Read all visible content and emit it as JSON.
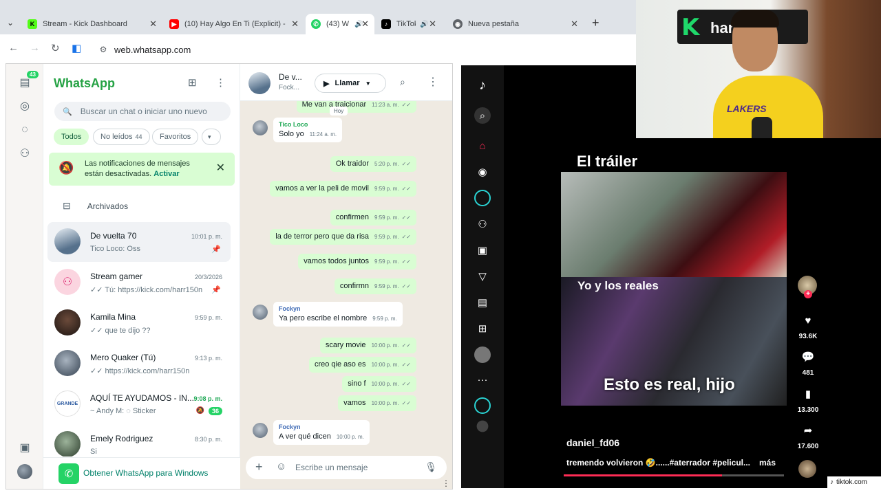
{
  "browser": {
    "tabs": [
      {
        "title": "Stream - Kick Dashboard",
        "icon": "kick-icon",
        "color": "#53fc18"
      },
      {
        "title": "(10) Hay Algo En Ti (Explicit) - Y",
        "icon": "youtube-icon",
        "color": "#ff0000"
      },
      {
        "title": "(43) W",
        "icon": "whatsapp-icon",
        "color": "#25d366"
      },
      {
        "title": "TikTok",
        "icon": "tiktok-icon",
        "color": "#000000"
      },
      {
        "title": "Nueva pestaña",
        "icon": "chrome-icon",
        "color": "#5f6368"
      }
    ],
    "url": "web.whatsapp.com"
  },
  "whatsapp": {
    "rail_badge": "43",
    "title": "WhatsApp",
    "search_placeholder": "Buscar un chat o iniciar uno nuevo",
    "filters": [
      {
        "label": "Todos",
        "count": ""
      },
      {
        "label": "No leídos",
        "count": "44"
      },
      {
        "label": "Favoritos",
        "count": ""
      }
    ],
    "notice": {
      "text": "Las notificaciones de mensajes están desactivadas.",
      "action": "Activar"
    },
    "archived_label": "Archivados",
    "chats": [
      {
        "name": "De vuelta 70",
        "preview": "Tico Loco: Oss",
        "time": "10:01 p. m.",
        "pinned": true
      },
      {
        "name": "Stream gamer",
        "preview": "✓✓ Tú: https://kick.com/harr150n",
        "time": "20/3/2026",
        "pinned": true
      },
      {
        "name": "Kamila Mina",
        "preview": "✓✓ que te dijo ??",
        "time": "9:59 p. m."
      },
      {
        "name": "Mero Quaker (Tú)",
        "preview": "✓✓ https://kick.com/harr150n",
        "time": "9:13 p. m."
      },
      {
        "name": "AQUÍ TE AYUDAMOS - IN...",
        "preview": "~ Andy M: ◌ Sticker",
        "time": "9:08 p. m.",
        "unread": "36",
        "muted": true
      },
      {
        "name": "Emely Rodriguez",
        "preview": "Si",
        "time": "8:30 p. m."
      }
    ],
    "get_app_label": "Obtener WhatsApp para Windows",
    "conversation": {
      "name": "De v...",
      "subtitle": "Fock...",
      "call_label": "Llamar",
      "day_label": "Hoy",
      "messages": [
        {
          "dir": "out",
          "text": "Me van a traicionar",
          "time": "11:23 a. m."
        },
        {
          "dir": "in",
          "sender": "Tico Loco",
          "text": "Solo yo",
          "time": "11:24 a. m."
        },
        {
          "dir": "out",
          "text": "Ok traidor",
          "time": "5:20 p. m."
        },
        {
          "dir": "out",
          "text": "vamos a ver la peli de movil",
          "time": "9:59 p. m."
        },
        {
          "dir": "out",
          "text": "confirmen",
          "time": "9:59 p. m."
        },
        {
          "dir": "out",
          "text": "la de terror pero que da risa",
          "time": "9:59 p. m."
        },
        {
          "dir": "out",
          "text": "vamos todos juntos",
          "time": "9:59 p. m."
        },
        {
          "dir": "out",
          "text": "confirmn",
          "time": "9:59 p. m."
        },
        {
          "dir": "in",
          "sender": "Fockyn",
          "text": "Ya pero escribe el nombre",
          "time": "9:59 p. m."
        },
        {
          "dir": "out",
          "text": "scary movie",
          "time": "10:00 p. m."
        },
        {
          "dir": "out",
          "text": "creo qie aso es",
          "time": "10:00 p. m."
        },
        {
          "dir": "out",
          "text": "sino f",
          "time": "10:00 p. m."
        },
        {
          "dir": "out",
          "text": "vamos",
          "time": "10:00 p. m."
        },
        {
          "dir": "in",
          "sender": "Fockyn",
          "text": "A ver qué dicen",
          "time": "10:00 p. m."
        }
      ],
      "composer_placeholder": "Escribe un mensaje"
    }
  },
  "tiktok": {
    "caption_top": "El tráiler",
    "caption_mid": "Yo y los reales",
    "caption_main": "Esto es real, hijo",
    "likes": "93.6K",
    "comments": "481",
    "saves": "13.300",
    "shares": "17.600",
    "username": "daniel_fd06",
    "description": "tremendo volvieron 🤣......#aterrador #pelicul...",
    "more_label": "más",
    "progress": 0.72,
    "domain": "tiktok.com"
  },
  "webcam": {
    "sign_letter": "K",
    "sign_text": "harr150n",
    "shirt_text": "LAKERS"
  }
}
